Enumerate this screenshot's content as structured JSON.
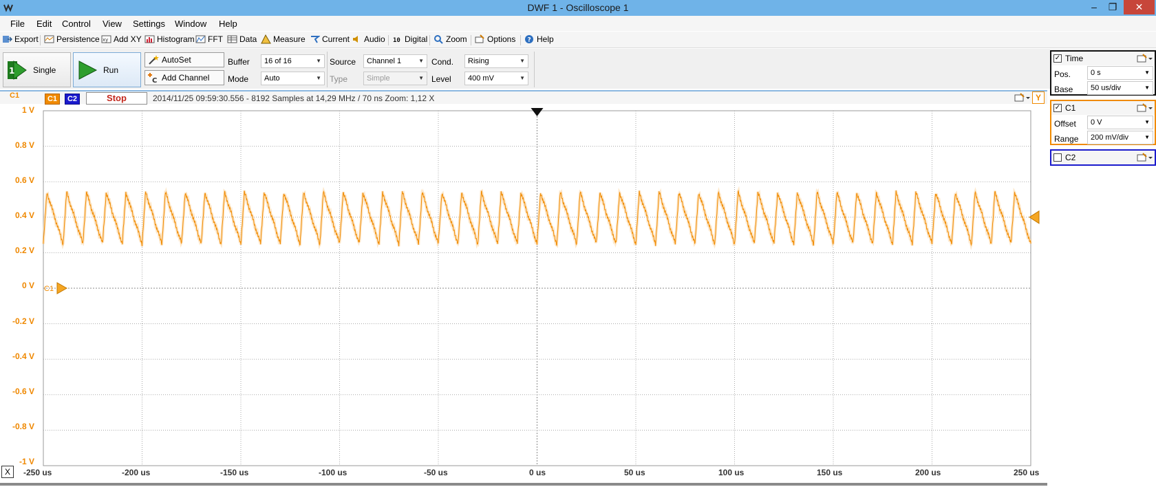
{
  "window": {
    "title": "DWF 1 - Oscilloscope 1",
    "min_glyph": "–",
    "max_glyph": "❐",
    "close_glyph": "✕"
  },
  "menu": [
    "File",
    "Edit",
    "Control",
    "View",
    "Settings",
    "Window",
    "Help"
  ],
  "toolbar": [
    {
      "label": "Export",
      "icon": "export-icon"
    },
    {
      "label": "Persistence",
      "icon": "persistence-icon"
    },
    {
      "label": "Add XY",
      "icon": "xy-icon"
    },
    {
      "label": "Histogram",
      "icon": "histogram-icon"
    },
    {
      "label": "FFT",
      "icon": "fft-icon"
    },
    {
      "label": "Data",
      "icon": "data-icon"
    },
    {
      "label": "Measure",
      "icon": "measure-icon"
    },
    {
      "label": "Current",
      "icon": "current-icon"
    },
    {
      "label": "Audio",
      "icon": "audio-icon"
    },
    {
      "label": "Digital",
      "icon": "digital-icon"
    },
    {
      "label": "Zoom",
      "icon": "zoom-icon"
    },
    {
      "label": "Options",
      "icon": "options-icon"
    },
    {
      "label": "Help",
      "icon": "help-icon"
    }
  ],
  "controls": {
    "single_label": "Single",
    "run_label": "Run",
    "autoset_label": "AutoSet",
    "add_channel_label": "Add Channel",
    "buffer_label": "Buffer",
    "buffer_value": "16 of 16",
    "mode_label": "Mode",
    "mode_value": "Auto",
    "source_label": "Source",
    "source_value": "Channel 1",
    "type_label": "Type",
    "type_value": "Simple",
    "cond_label": "Cond.",
    "cond_value": "Rising",
    "level_label": "Level",
    "level_value": "400 mV"
  },
  "scope": {
    "c1_tag": "C1",
    "c2_tag": "C2",
    "channel_corner": "C1",
    "stop_label": "Stop",
    "status_text": "2014/11/25 09:59:30.556 - 8192 Samples at 14,29 MHz / 70 ns Zoom: 1,12 X",
    "y_button": "Y",
    "x_button": "X",
    "marker_label": "C1"
  },
  "panels": {
    "time": {
      "title": "Time",
      "checked": true,
      "pos_label": "Pos.",
      "pos_value": "0 s",
      "base_label": "Base",
      "base_value": "50 us/div"
    },
    "c1": {
      "title": "C1",
      "checked": true,
      "offset_label": "Offset",
      "offset_value": "0 V",
      "range_label": "Range",
      "range_value": "200 mV/div"
    },
    "c2": {
      "title": "C2",
      "checked": false
    }
  },
  "colors": {
    "c1": "#f08a00",
    "c2": "#1a1acc",
    "grid": "#9a9a9a",
    "title_bar": "#6fb3e8"
  },
  "chart_data": {
    "type": "line",
    "x_ticks": [
      "-250 us",
      "-200 us",
      "-150 us",
      "-100 us",
      "-50 us",
      "0 us",
      "50 us",
      "100 us",
      "150 us",
      "200 us",
      "250 us"
    ],
    "y_ticks": [
      "1 V",
      "0.8 V",
      "0.6 V",
      "0.4 V",
      "0.2 V",
      "0 V",
      "-0.2 V",
      "-0.4 V",
      "-0.6 V",
      "-0.8 V",
      "-1 V"
    ],
    "xlim": [
      -250,
      250
    ],
    "ylim": [
      -1,
      1
    ],
    "grid": true,
    "series": [
      {
        "name": "C1",
        "waveform": "sawtooth",
        "period_us": 10,
        "min_v": 0.25,
        "max_v": 0.54,
        "color": "#f08a00"
      }
    ],
    "trigger_time_us": 0,
    "trigger_level_v": 0.4,
    "channel_offset_v": 0
  }
}
